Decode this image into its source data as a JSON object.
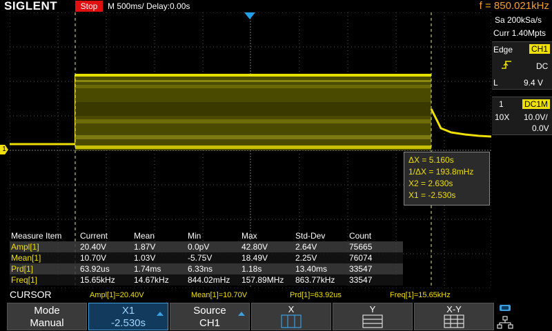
{
  "header": {
    "logo": "SIGLENT",
    "run_state": "Stop",
    "timebase": "M 500ms/  Delay:0.00s",
    "frequency": "f = 850.021kHz"
  },
  "acquisition": {
    "sample_rate": "Sa 200kSa/s",
    "memory_depth": "Curr 1.40Mpts"
  },
  "trigger": {
    "type": "Edge",
    "source": "CH1",
    "slope_icon": "rising-edge-icon",
    "coupling": "DC",
    "level_label": "L",
    "level": "9.4 V"
  },
  "channel": {
    "number": "1",
    "coupling": "DC1M",
    "probe": "10X",
    "scale": "10.0V/",
    "offset": "0.0V"
  },
  "ch1_marker": "1",
  "cursor_readout": {
    "delta_x": "ΔX = 5.160s",
    "inv_delta_x": "1/ΔX = 193.8mHz",
    "x2": "X2 = 2.630s",
    "x1": "X1 = -2.530s"
  },
  "measure": {
    "headers": [
      "Measure Item",
      "Current",
      "Mean",
      "Min",
      "Max",
      "Std-Dev",
      "Count"
    ],
    "rows": [
      [
        "Ampl[1]",
        "20.40V",
        "1.87V",
        "0.0pV",
        "42.80V",
        "2.64V",
        "75665"
      ],
      [
        "Mean[1]",
        "10.70V",
        "1.03V",
        "-5.75V",
        "18.49V",
        "2.25V",
        "76074"
      ],
      [
        "Prd[1]",
        "63.92us",
        "1.74ms",
        "6.33ns",
        "1.18s",
        "13.40ms",
        "33547"
      ],
      [
        "Freq[1]",
        "15.65kHz",
        "14.67kHz",
        "844.02mHz",
        "157.89MHz",
        "863.77kHz",
        "33547"
      ]
    ]
  },
  "status": {
    "menu_title": "CURSOR",
    "items": [
      "Ampl[1]=20.40V",
      "Mean[1]=10.70V",
      "Prd[1]=63.92us",
      "Freq[1]=15.65kHz"
    ]
  },
  "softkeys": [
    {
      "line1": "Mode",
      "line2": "Manual"
    },
    {
      "line1": "X1",
      "line2": "-2.530s"
    },
    {
      "line1": "Source",
      "line2": "CH1"
    },
    {
      "line1": "X",
      "icon": "x-cursor-icon"
    },
    {
      "line1": "Y",
      "icon": "y-cursor-icon"
    },
    {
      "line1": "X-Y",
      "icon": "xy-cursor-icon"
    }
  ],
  "colors": {
    "ch1": "#f0e000",
    "accent": "#21a0e8",
    "frequency": "#f7a02a",
    "stop": "#e01010"
  }
}
